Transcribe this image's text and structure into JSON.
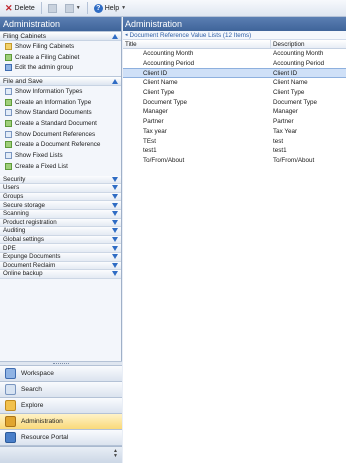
{
  "toolbar": {
    "delete_label": "Delete",
    "help_label": "Help"
  },
  "left": {
    "title": "Administration",
    "groups": [
      {
        "title": "Filing Cabinets",
        "items": [
          "Show Filing Cabinets",
          "Create a Filing Cabinet",
          "Edit the admin group"
        ]
      },
      {
        "title": "File and Save",
        "items": [
          "Show Information Types",
          "Create an Information Type",
          "Show Standard Documents",
          "Create a Standard Document",
          "Show Document References",
          "Create a Document Reference",
          "Show Fixed Lists",
          "Create a Fixed List"
        ]
      }
    ],
    "collapsed": [
      "Security",
      "Users",
      "Groups",
      "Secure storage",
      "Scanning",
      "Product registration",
      "Auditing",
      "Global settings",
      "DPE",
      "Expunge Documents",
      "Document Reclaim",
      "Online backup"
    ],
    "nav": [
      "Workspace",
      "Search",
      "Explore",
      "Administration",
      "Resource Portal"
    ]
  },
  "right": {
    "title": "Administration",
    "subheading": "Document Reference Value Lists (12 Items)",
    "columns": [
      "Title",
      "Description"
    ],
    "rows": [
      [
        "Accounting Month",
        "Accounting Month"
      ],
      [
        "Accounting Period",
        "Accounting Period"
      ],
      [
        "Client ID",
        "Client ID"
      ],
      [
        "Client Name",
        "Client Name"
      ],
      [
        "Client Type",
        "Client Type"
      ],
      [
        "Document Type",
        "Document Type"
      ],
      [
        "Manager",
        "Manager"
      ],
      [
        "Partner",
        "Partner"
      ],
      [
        "Tax year",
        "Tax Year"
      ],
      [
        "TEst",
        "test"
      ],
      [
        "test1",
        "test1"
      ],
      [
        "To/From/About",
        "To/From/About"
      ]
    ],
    "selected_row": 2
  },
  "colors": {
    "header_blue": "#3f6499",
    "selection": "#cfe0f7",
    "active_nav": "#f9d97a"
  }
}
